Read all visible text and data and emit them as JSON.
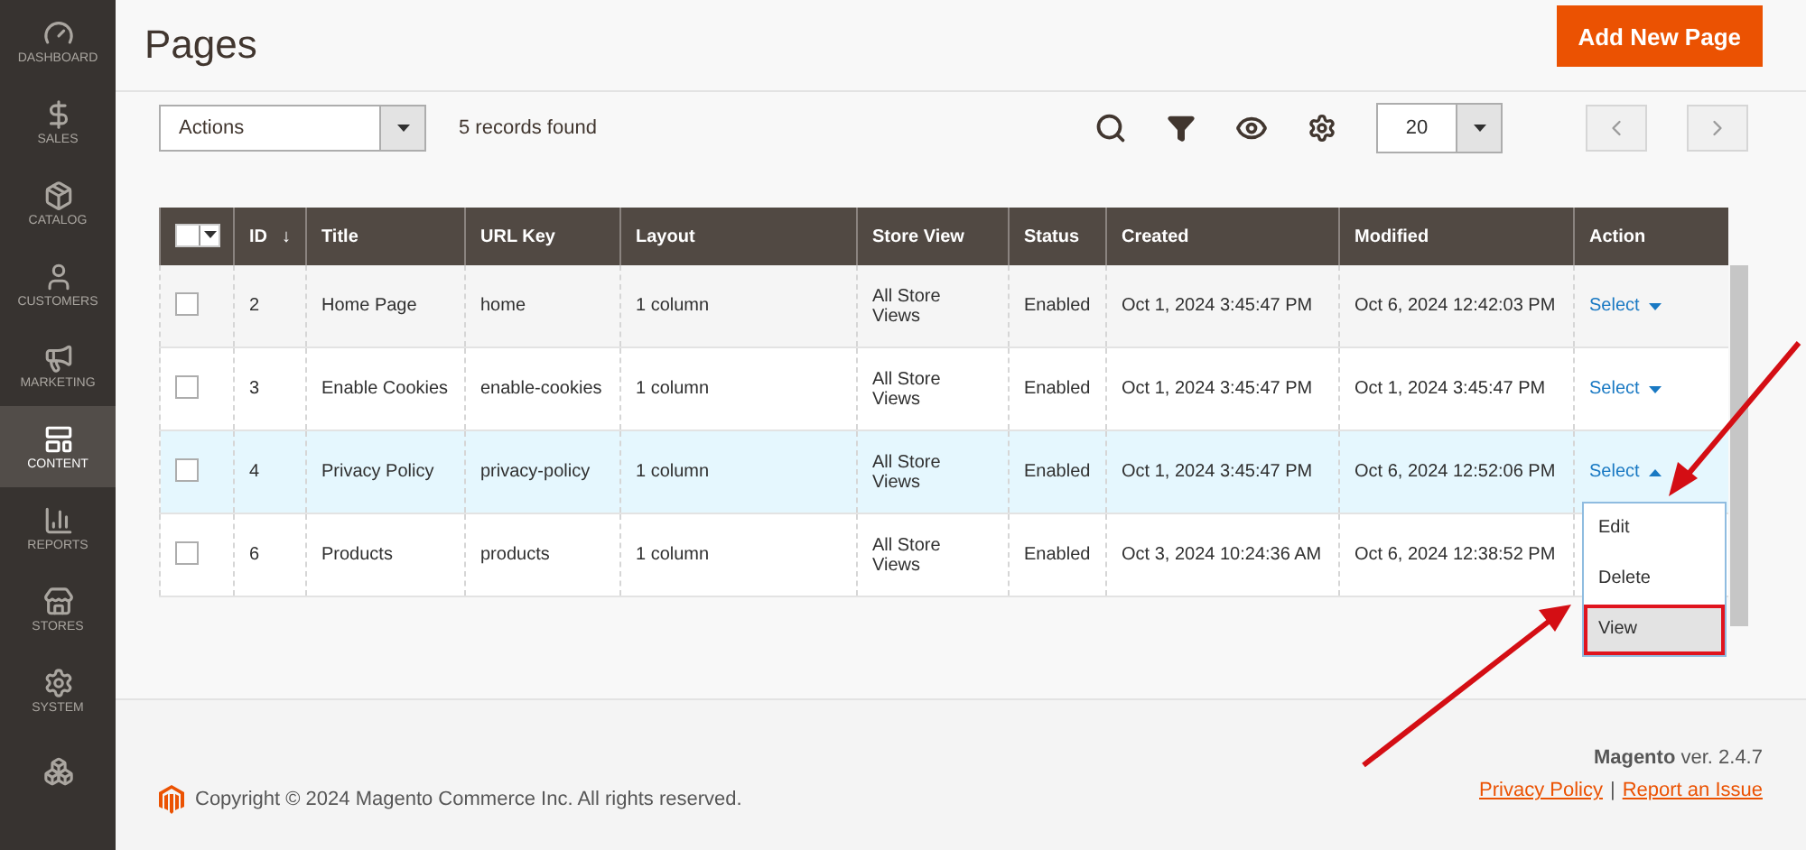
{
  "sidebar": {
    "items": [
      {
        "label": "DASHBOARD",
        "selected": false
      },
      {
        "label": "SALES",
        "selected": false
      },
      {
        "label": "CATALOG",
        "selected": false
      },
      {
        "label": "CUSTOMERS",
        "selected": false
      },
      {
        "label": "MARKETING",
        "selected": false
      },
      {
        "label": "CONTENT",
        "selected": true
      },
      {
        "label": "REPORTS",
        "selected": false
      },
      {
        "label": "STORES",
        "selected": false
      },
      {
        "label": "SYSTEM",
        "selected": false
      },
      {
        "selected": false
      }
    ]
  },
  "page_title": "Pages",
  "add_button": "Add New Page",
  "toolbar": {
    "actions_select": "Actions",
    "records_found": "5 records found",
    "per_page": "20"
  },
  "table": {
    "mass_select": {
      "checked": false
    },
    "columns": [
      {
        "label": "ID",
        "sort_mark": "↓"
      },
      {
        "label": "Title"
      },
      {
        "label": "URL Key"
      },
      {
        "label": "Layout"
      },
      {
        "label": "Store View"
      },
      {
        "label": "Status"
      },
      {
        "label": "Created"
      },
      {
        "label": "Modified"
      },
      {
        "label": "Action"
      }
    ],
    "rows": [
      {
        "checked": false,
        "highlighted": false,
        "cells": [
          "2",
          "Home Page",
          "home",
          "1 column",
          "All Store Views",
          "Enabled",
          "Oct 1, 2024 3:45:47 PM",
          "Oct 6, 2024 12:42:03 PM"
        ],
        "action": "Select",
        "menu_open": false
      },
      {
        "checked": false,
        "highlighted": false,
        "cells": [
          "3",
          "Enable Cookies",
          "enable-cookies",
          "1 column",
          "All Store Views",
          "Enabled",
          "Oct 1, 2024 3:45:47 PM",
          "Oct 1, 2024 3:45:47 PM"
        ],
        "action": "Select",
        "menu_open": false
      },
      {
        "checked": false,
        "highlighted": true,
        "cells": [
          "4",
          "Privacy Policy",
          "privacy-policy",
          "1 column",
          "All Store Views",
          "Enabled",
          "Oct 1, 2024 3:45:47 PM",
          "Oct 6, 2024 12:52:06 PM"
        ],
        "action": "Select",
        "menu_open": true,
        "menu": [
          {
            "label": "Edit",
            "selected": false
          },
          {
            "label": "Delete",
            "selected": false
          },
          {
            "label": "View",
            "selected": true
          }
        ]
      },
      {
        "checked": false,
        "highlighted": false,
        "cells": [
          "6",
          "Products",
          "products",
          "1 column",
          "All Store Views",
          "Enabled",
          "Oct 3, 2024 10:24:36 AM",
          "Oct 6, 2024 12:38:52 PM"
        ]
      }
    ]
  },
  "footer": {
    "copyright": "Copyright © 2024 Magento Commerce Inc. All rights reserved.",
    "brand": "Magento",
    "version": "ver. 2.4.7",
    "links": [
      "Privacy Policy",
      "Report an Issue"
    ],
    "separator": "|"
  }
}
